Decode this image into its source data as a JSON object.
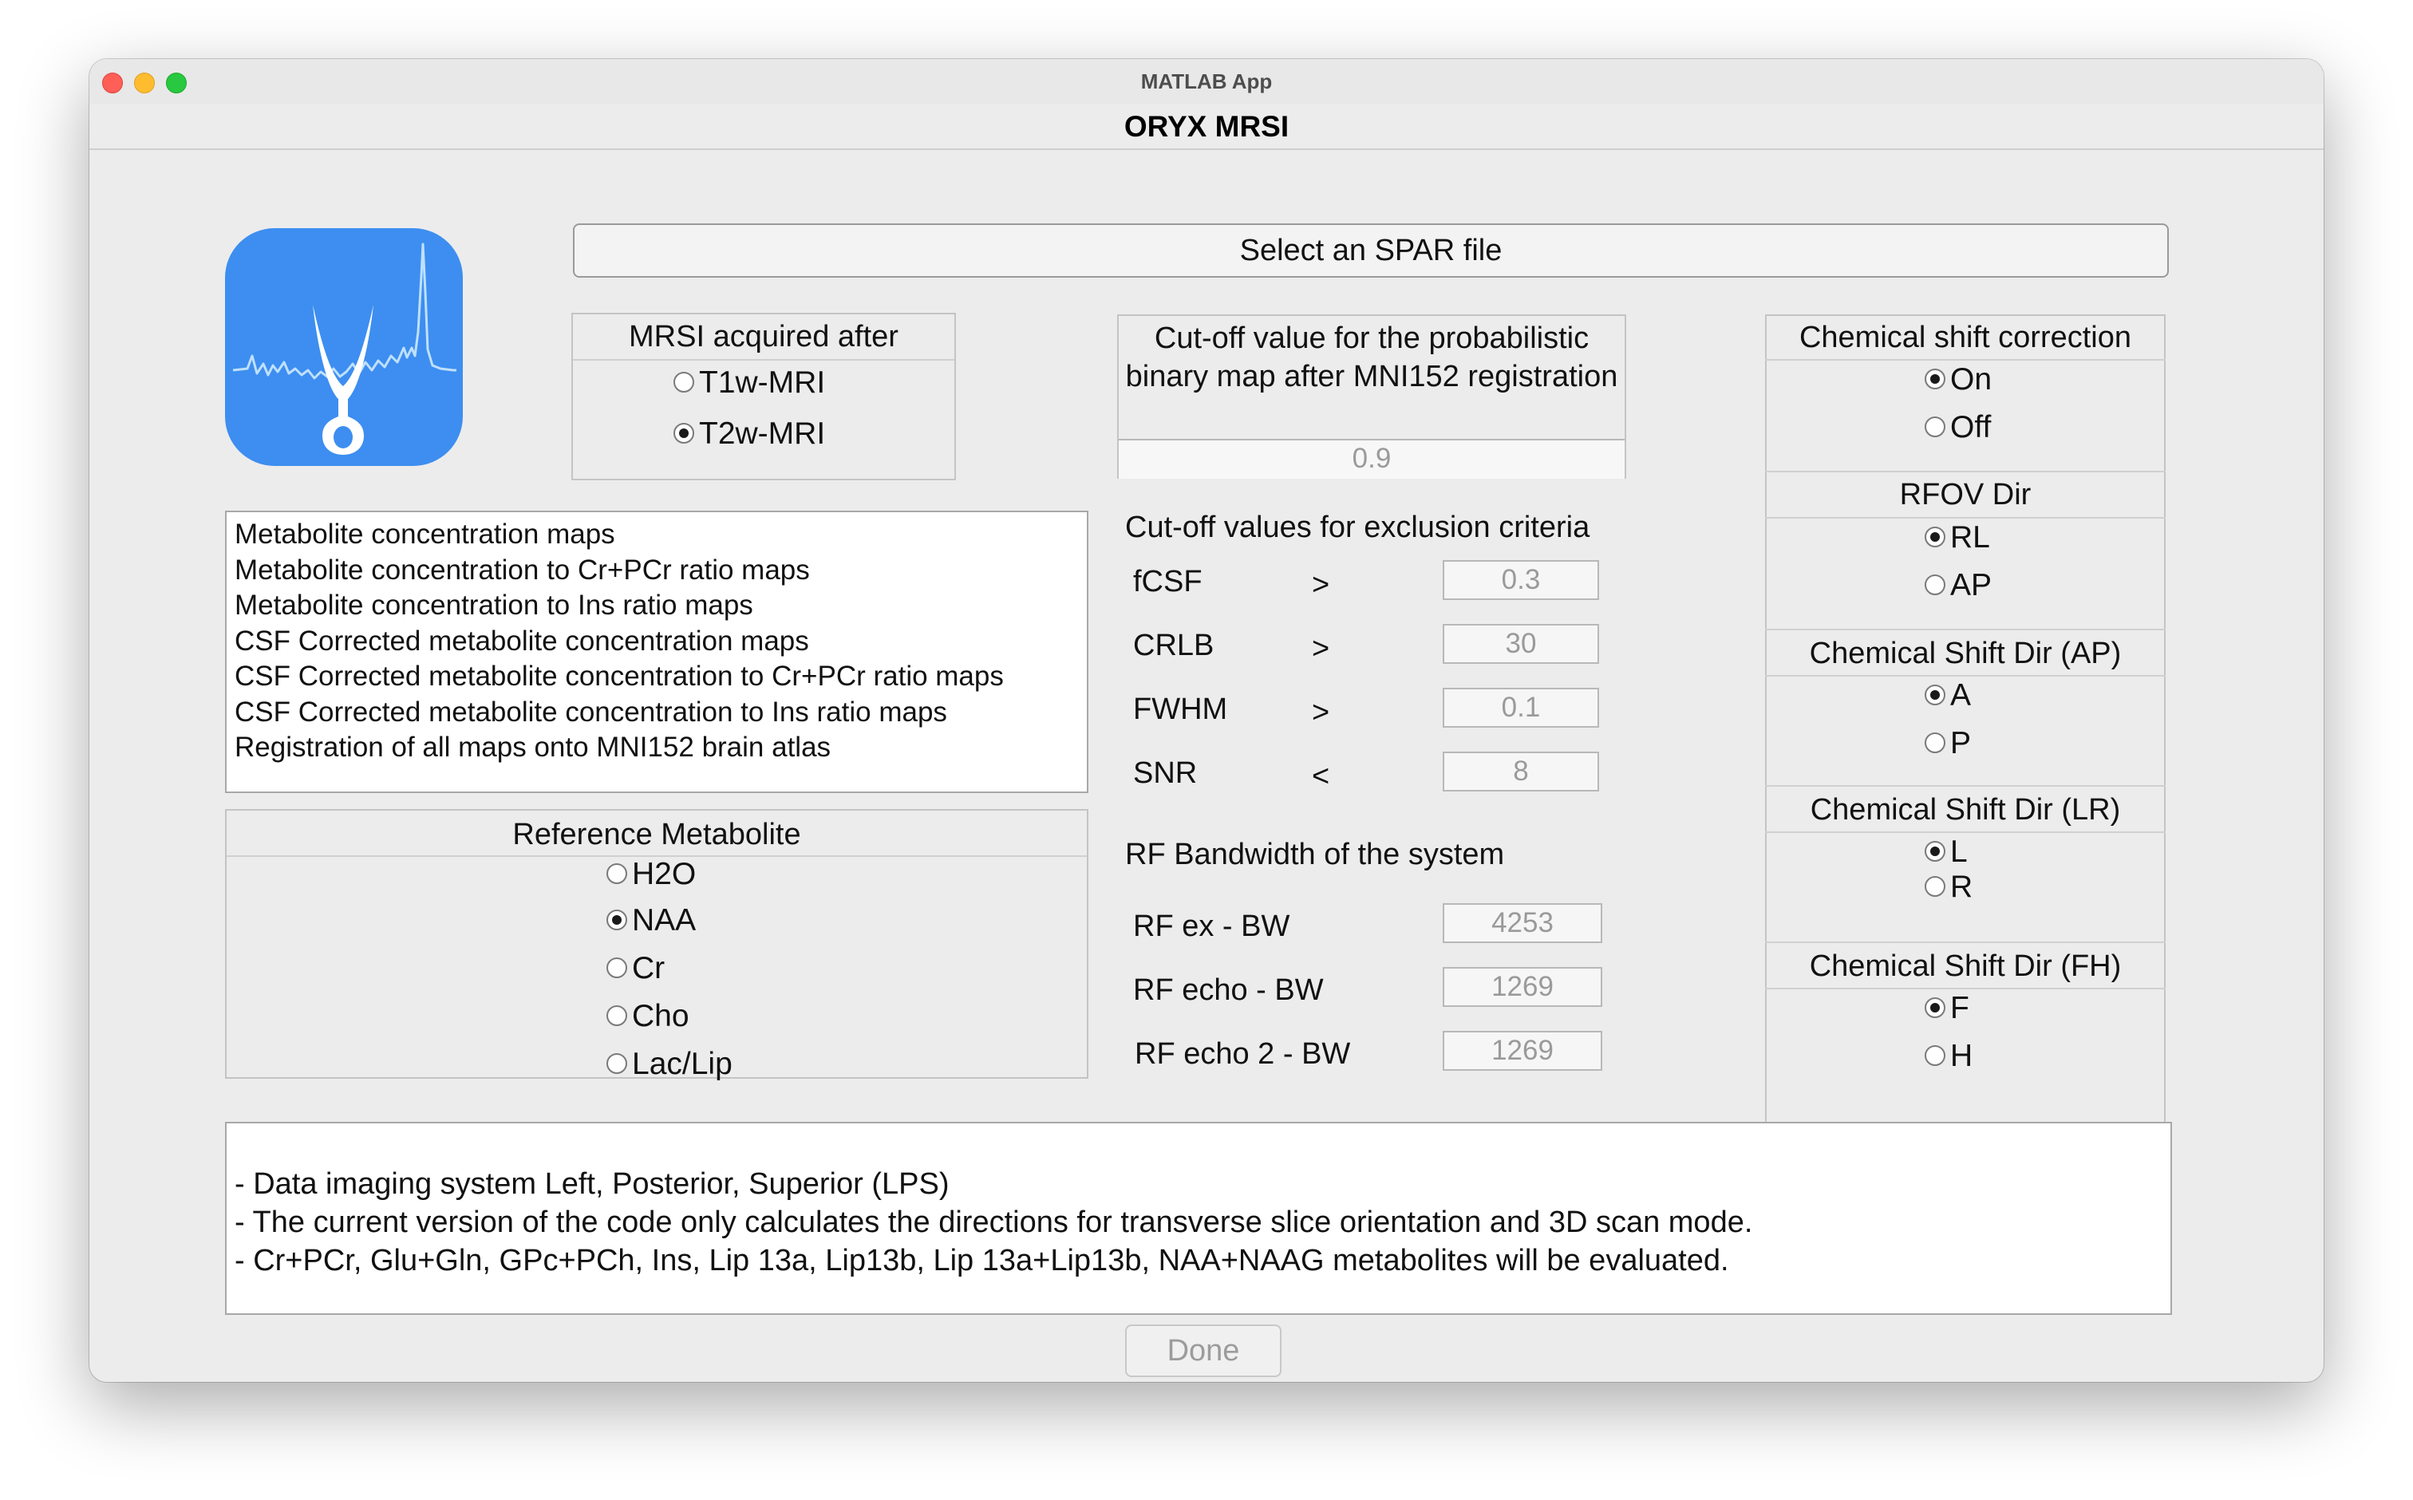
{
  "window": {
    "title": "MATLAB App"
  },
  "app": {
    "title": "ORYX MRSI"
  },
  "spar_button": "Select an SPAR file",
  "acquired": {
    "title": "MRSI acquired after",
    "options": [
      "T1w-MRI",
      "T2w-MRI"
    ],
    "selected": "T2w-MRI"
  },
  "cutoff_prob": {
    "title": "Cut-off value for the probabilistic binary map after MNI152 registration",
    "value": "0.9"
  },
  "outputs": [
    "Metabolite concentration maps",
    "Metabolite concentration to Cr+PCr ratio maps",
    "Metabolite concentration to Ins ratio maps",
    "CSF Corrected metabolite concentration maps",
    "CSF Corrected metabolite concentration to Cr+PCr ratio maps",
    "CSF Corrected metabolite concentration to Ins ratio maps",
    "Registration of all maps onto MNI152 brain atlas"
  ],
  "exclusion": {
    "title": "Cut-off values for exclusion criteria",
    "rows": [
      {
        "label": "fCSF",
        "op": ">",
        "value": "0.3"
      },
      {
        "label": "CRLB",
        "op": ">",
        "value": "30"
      },
      {
        "label": "FWHM",
        "op": ">",
        "value": "0.1"
      },
      {
        "label": "SNR",
        "op": "<",
        "value": "8"
      }
    ]
  },
  "bandwidth": {
    "title": "RF Bandwidth of the system",
    "rows": [
      {
        "label": "RF ex - BW",
        "value": "4253"
      },
      {
        "label": "RF echo - BW",
        "value": "1269"
      },
      {
        "label": "RF echo 2 - BW",
        "value": "1269"
      }
    ]
  },
  "reference": {
    "title": "Reference Metabolite",
    "options": [
      "H2O",
      "NAA",
      "Cr",
      "Cho",
      "Lac/Lip"
    ],
    "selected": "NAA"
  },
  "shift_correction": {
    "title": "Chemical shift correction",
    "options": [
      "On",
      "Off"
    ],
    "selected": "On"
  },
  "rfov": {
    "title": "RFOV Dir",
    "options": [
      "RL",
      "AP"
    ],
    "selected": "RL"
  },
  "shift_ap": {
    "title": "Chemical Shift Dir (AP)",
    "options": [
      "A",
      "P"
    ],
    "selected": "A"
  },
  "shift_lr": {
    "title": "Chemical Shift Dir (LR)",
    "options": [
      "L",
      "R"
    ],
    "selected": "L"
  },
  "shift_fh": {
    "title": "Chemical Shift Dir (FH)",
    "options": [
      "F",
      "H"
    ],
    "selected": "F"
  },
  "notes": [
    "- Data imaging system Left, Posterior, Superior (LPS)",
    "- The current version of the code only calculates the directions for transverse slice orientation and 3D scan mode.",
    "- Cr+PCr, Glu+Gln, GPc+PCh, Ins, Lip 13a, Lip13b, Lip 13a+Lip13b, NAA+NAAG metabolites will be evaluated."
  ],
  "done_button": "Done",
  "colors": {
    "icon_bg": "#3d8ef0",
    "window_bg": "#ececec"
  }
}
